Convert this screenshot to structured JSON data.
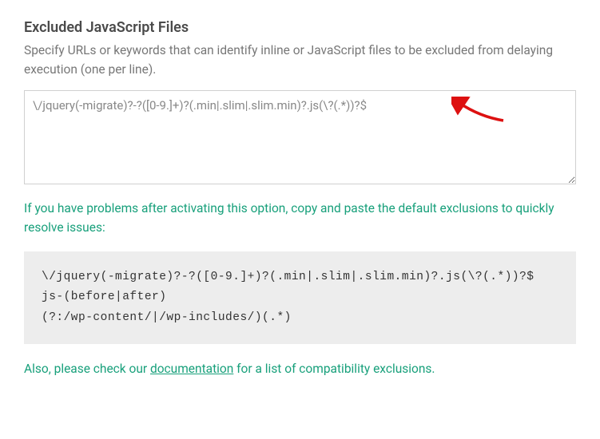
{
  "section": {
    "title": "Excluded JavaScript Files",
    "description": "Specify URLs or keywords that can identify inline or JavaScript files to be excluded from delaying execution (one per line).",
    "textarea_value": "\\/jquery(-migrate)?-?([0-9.]+)?(.min|.slim|.slim.min)?.js(\\?(.*))?$"
  },
  "hint": {
    "lead": "If you have problems after activating this option, copy and paste the default exclusions to quickly resolve issues:"
  },
  "default_exclusions": "\\/jquery(-migrate)?-?([0-9.]+)?(.min|.slim|.slim.min)?.js(\\?(.*))?$\njs-(before|after)\n(?:/wp-content/|/wp-includes/)(.*)",
  "footer": {
    "prefix": "Also, please check our ",
    "link_text": "documentation",
    "suffix": " for a list of compatibility exclusions."
  }
}
